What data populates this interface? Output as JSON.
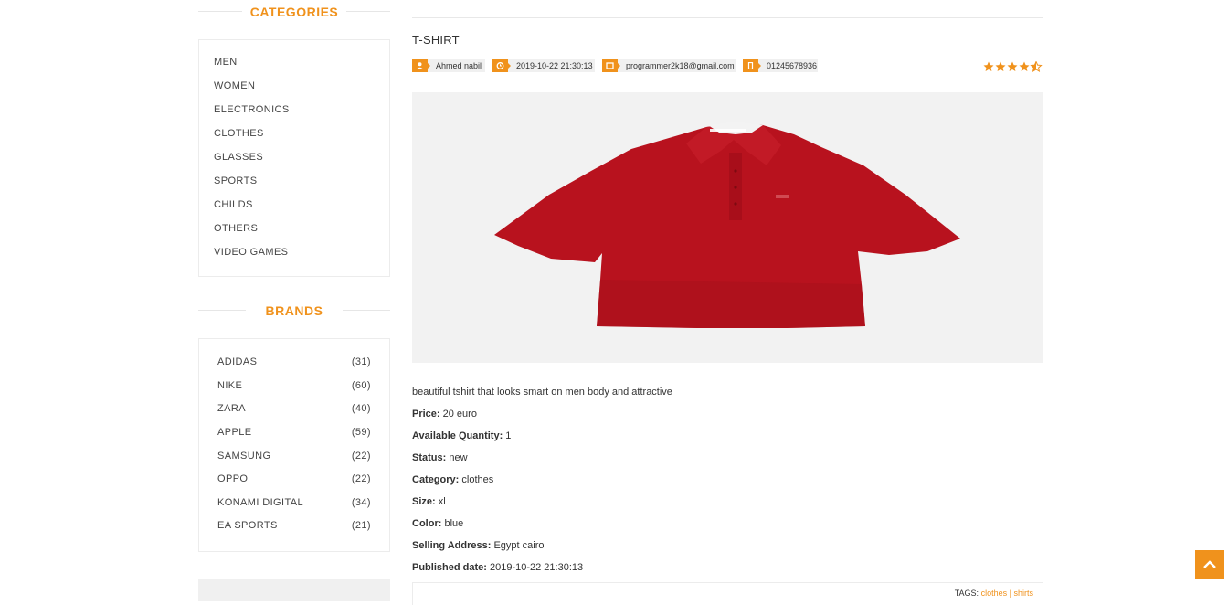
{
  "sidebar": {
    "categories_title": "CATEGORIES",
    "categories": [
      "MEN",
      "WOMEN",
      "ELECTRONICS",
      "CLOTHES",
      "GLASSES",
      "SPORTS",
      "CHILDS",
      "OTHERS",
      "VIDEO GAMES"
    ],
    "brands_title": "BRANDS",
    "brands": [
      {
        "name": "ADIDAS",
        "count": "(31)"
      },
      {
        "name": "NIKE",
        "count": "(60)"
      },
      {
        "name": "ZARA",
        "count": "(40)"
      },
      {
        "name": "APPLE",
        "count": "(59)"
      },
      {
        "name": "SAMSUNG",
        "count": "(22)"
      },
      {
        "name": "OPPO",
        "count": "(22)"
      },
      {
        "name": "KONAMI DIGITAL",
        "count": "(34)"
      },
      {
        "name": "EA SPORTS",
        "count": "(21)"
      }
    ]
  },
  "product": {
    "title": "T-SHIRT",
    "meta": {
      "author": "Ahmed nabil",
      "date": "2019-10-22 21:30:13",
      "email": "programmer2k18@gmail.com",
      "phone": "01245678936"
    },
    "rating": 4.5,
    "image_icon": "red-polo-shirt",
    "description": "beautiful tshirt that looks smart on men body and attractive",
    "details": [
      {
        "label": "Price:",
        "value": "20 euro"
      },
      {
        "label": "Available Quantity:",
        "value": "1"
      },
      {
        "label": "Status:",
        "value": "new"
      },
      {
        "label": "Category:",
        "value": "clothes"
      },
      {
        "label": "Size:",
        "value": "xl"
      },
      {
        "label": "Color:",
        "value": "blue"
      },
      {
        "label": "Selling Address:",
        "value": "Egypt cairo"
      },
      {
        "label": "Published date:",
        "value": "2019-10-22 21:30:13"
      }
    ],
    "tags_label": "TAGS:",
    "tags": [
      "clothes",
      "shirts"
    ],
    "tags_separator": "|"
  },
  "icons": {
    "user": "user-icon",
    "clock": "clock-icon",
    "email": "mail-icon",
    "phone": "phone-icon",
    "star": "star-icon",
    "scroll_top": "chevron-up-icon"
  },
  "colors": {
    "accent": "#f0921c",
    "shirt": "#b8121e"
  }
}
